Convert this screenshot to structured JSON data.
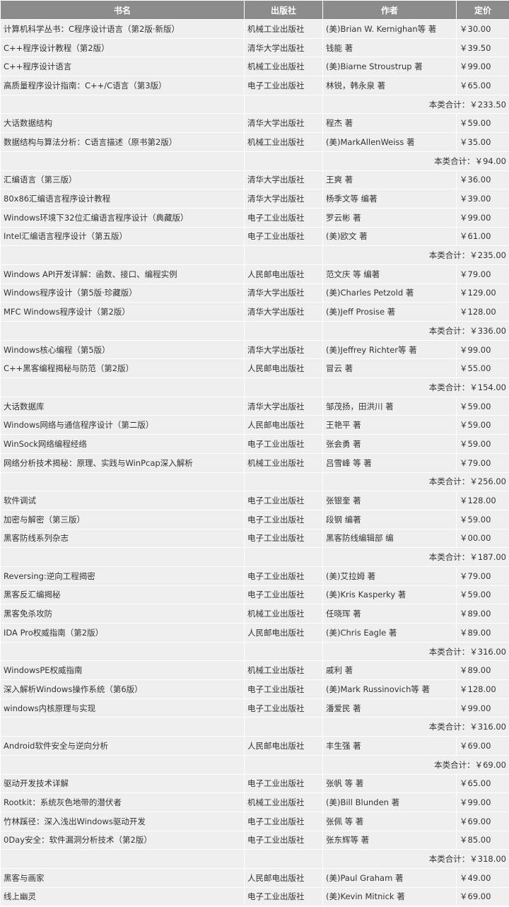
{
  "headers": [
    "书名",
    "出版社",
    "作者",
    "定价"
  ],
  "groups": [
    {
      "books": [
        [
          "计算机科学丛书：C程序设计语言（第2版·新版）",
          "机械工业出版社",
          "(美)Brian W. Kernighan等 著",
          "￥30.00"
        ],
        [
          "C++程序设计教程（第2版）",
          "清华大学出版社",
          "钱能 著",
          "￥39.50"
        ],
        [
          "C++程序设计语言",
          "机械工业出版社",
          "(美)Biarne Stroustrup 著",
          "￥99.00"
        ],
        [
          "高质量程序设计指南：C++/C语言（第3版）",
          "电子工业出版社",
          "林锐，韩永泉 著",
          "￥65.00"
        ]
      ],
      "subtotal": "本类合计：￥233.50"
    },
    {
      "books": [
        [
          "大话数据结构",
          "清华大学出版社",
          "程杰 著",
          "￥59.00"
        ],
        [
          "数据结构与算法分析：C语言描述（原书第2版）",
          "机械工业出版社",
          "(美)MarkAllenWeiss 著",
          "￥35.00"
        ]
      ],
      "subtotal": "本类合计：￥94.00"
    },
    {
      "books": [
        [
          "汇编语言（第三版）",
          "清华大学出版社",
          "王爽 著",
          "￥36.00"
        ],
        [
          "80x86汇编语言程序设计教程",
          "清华大学出版社",
          "杨季文等 编著",
          "￥39.00"
        ],
        [
          "Windows环境下32位汇编语言程序设计（典藏版）",
          "电子工业出版社",
          "罗云彬 著",
          "￥99.00"
        ],
        [
          "Intel汇编语言程序设计（第五版）",
          "电子工业出版社",
          "(美)欧文 著",
          "￥61.00"
        ]
      ],
      "subtotal": "本类合计：￥235.00"
    },
    {
      "books": [
        [
          "Windows API开发详解：函数、接口、编程实例",
          "人民邮电出版社",
          "范文庆 等 编著",
          "￥79.00"
        ],
        [
          "Windows程序设计（第5版·珍藏版）",
          "清华大学出版社",
          "(美)Charles Petzold 著",
          "￥129.00"
        ],
        [
          "MFC Windows程序设计（第2版）",
          "清华大学出版社",
          "(美)Jeff Prosise 著",
          "￥128.00"
        ]
      ],
      "subtotal": "本类合计：￥336.00"
    },
    {
      "books": [
        [
          "Windows核心编程（第5版）",
          "清华大学出版社",
          "(美)Jeffrey Richter等 著",
          "￥99.00"
        ],
        [
          "C++黑客编程揭秘与防范（第2版）",
          "人民邮电出版社",
          "冒云 著",
          "￥55.00"
        ]
      ],
      "subtotal": "本类合计：￥154.00"
    },
    {
      "books": [
        [
          "大话数据库",
          "清华大学出版社",
          "邹茂扬，田洪川 著",
          "￥59.00"
        ],
        [
          "Windows网络与通信程序设计（第二版）",
          "人民邮电出版社",
          "王艳平 著",
          "￥59.00"
        ],
        [
          "WinSock网络编程经络",
          "电子工业出版社",
          "张会勇 著",
          "￥59.00"
        ],
        [
          "网络分析技术揭秘：原理、实践与WinPcap深入解析",
          "机械工业出版社",
          "吕雪峰 等 著",
          "￥79.00"
        ]
      ],
      "subtotal": "本类合计：￥256.00"
    },
    {
      "books": [
        [
          "软件调试",
          "电子工业出版社",
          "张银奎 著",
          "￥128.00"
        ],
        [
          "加密与解密（第三版）",
          "电子工业出版社",
          "段钢 编著",
          "￥59.00"
        ],
        [
          "黑客防线系列杂志",
          "电子工业出版社",
          "黑客防线编辑部 编",
          "￥00.00"
        ]
      ],
      "subtotal": "本类合计：￥187.00"
    },
    {
      "books": [
        [
          "Reversing:逆向工程揭密",
          "电子工业出版社",
          "(美)艾拉姆 著",
          "￥79.00"
        ],
        [
          "黑客反汇编揭秘",
          "电子工业出版社",
          "(美)Kris Kasperky 著",
          "￥59.00"
        ],
        [
          "黑客免杀攻防",
          "机械工业出版社",
          "任晓珲 著",
          "￥89.00"
        ],
        [
          "IDA Pro权威指南（第2版）",
          "人民邮电出版社",
          "(美)Chris Eagle 著",
          "￥89.00"
        ]
      ],
      "subtotal": "本类合计：￥316.00"
    },
    {
      "books": [
        [
          "WindowsPE权威指南",
          "机械工业出版社",
          "戚利 著",
          "￥89.00"
        ],
        [
          "深入解析Windows操作系统（第6版）",
          "电子工业出版社",
          "(美)Mark Russinovich等 著",
          "￥128.00"
        ],
        [
          "windows内核原理与实现",
          "电子工业出版社",
          "潘爱民 著",
          "￥99.00"
        ]
      ],
      "subtotal": "本类合计：￥316.00"
    },
    {
      "books": [
        [
          "Android软件安全与逆向分析",
          "人民邮电出版社",
          "丰生强 著",
          "￥69.00"
        ]
      ],
      "subtotal": "本类合计：￥69.00"
    },
    {
      "books": [
        [
          "驱动开发技术详解",
          "电子工业出版社",
          "张帆 等 著",
          "￥65.00"
        ],
        [
          "Rootkit：系统灰色地带的潜伏者",
          "机械工业出版社",
          "(美)Bill Blunden 著",
          "￥99.00"
        ],
        [
          "竹林蹊径：深入浅出Windows驱动开发",
          "电子工业出版社",
          "张佩 等 著",
          "￥69.00"
        ],
        [
          "0Day安全：软件漏洞分析技术（第2版）",
          "电子工业出版社",
          "张东辉等 著",
          "￥85.00"
        ]
      ],
      "subtotal": "本类合计：￥318.00"
    },
    {
      "books": [
        [
          "黑客与画家",
          "人民邮电出版社",
          "(美)Paul Graham 著",
          "￥49.00"
        ],
        [
          "线上幽灵",
          "电子工业出版社",
          "(美)Kevin Mitnick 著",
          "￥69.00"
        ]
      ],
      "subtotal": null
    }
  ]
}
